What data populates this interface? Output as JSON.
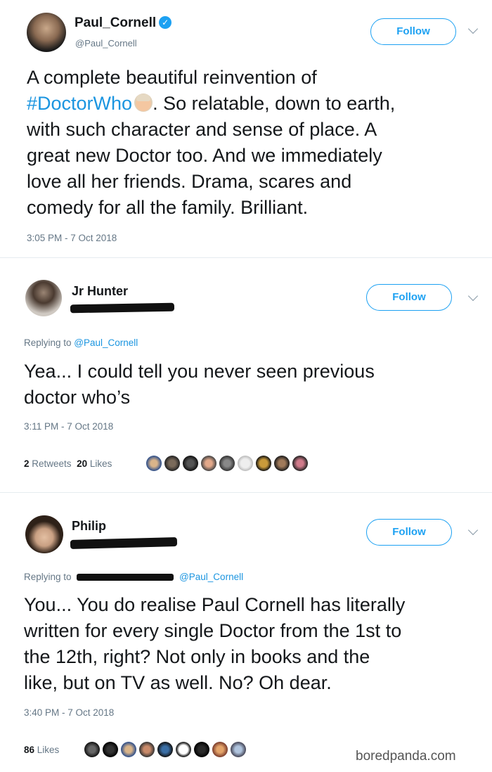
{
  "tweets": [
    {
      "name": "Paul_Cornell",
      "handle": "@Paul_Cornell",
      "verified": true,
      "follow_label": "Follow",
      "text_before": "A complete beautiful reinvention of",
      "hashtag": "#DoctorWho",
      "text_after_lines": [
        ".  So relatable, down to earth,",
        "with such character and sense of place.  A",
        "great new Doctor too.  And we immediately",
        "love all her friends.  Drama, scares and",
        "comedy for all the family. Brilliant."
      ],
      "timestamp": "3:05 PM - 7 Oct 2018"
    },
    {
      "name": "Jr Hunter",
      "follow_label": "Follow",
      "replying_prefix": "Replying to ",
      "replying_link": "@Paul_Cornell",
      "text_lines": [
        "Yea... I could tell you never seen previous",
        "doctor who’s"
      ],
      "timestamp": "3:11 PM - 7 Oct 2018",
      "retweets_count": "2",
      "retweets_label": "Retweets",
      "likes_count": "20",
      "likes_label": "Likes"
    },
    {
      "name": "Philip",
      "follow_label": "Follow",
      "replying_prefix": "Replying to",
      "replying_link": "@Paul_Cornell",
      "text_lines": [
        "You... You do realise Paul Cornell has literally",
        "written for every single Doctor from the 1st to",
        "the 12th, right? Not only in books and the",
        "like, but on TV as well. No? Oh dear."
      ],
      "timestamp": "3:40 PM - 7 Oct 2018",
      "likes_count": "86",
      "likes_label": "Likes"
    }
  ],
  "watermark": "boredpanda.com",
  "colors": {
    "accent": "#1da1f2",
    "link": "#1b95e0",
    "muted": "#657786"
  }
}
